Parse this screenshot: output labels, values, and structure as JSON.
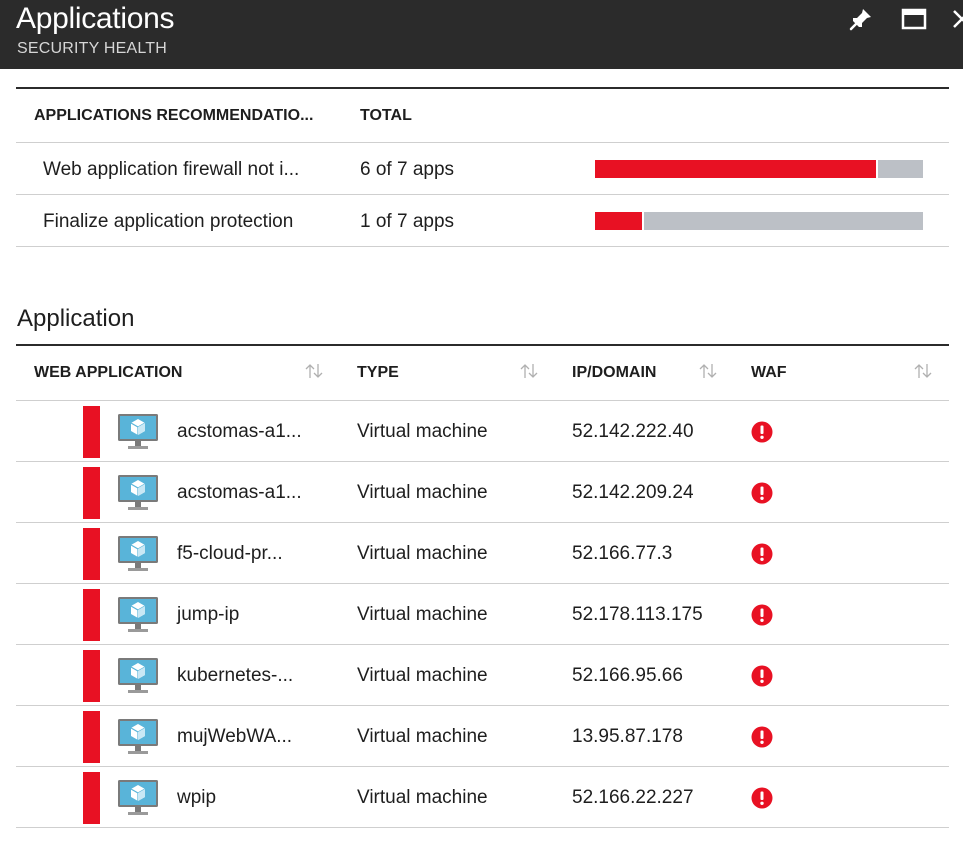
{
  "header": {
    "title": "Applications",
    "subtitle": "SECURITY HEALTH",
    "icons": [
      "pin-icon",
      "maximize-icon",
      "close-icon"
    ]
  },
  "recommendations": {
    "columns": [
      "APPLICATIONS RECOMMENDATIO...",
      "TOTAL"
    ],
    "rows": [
      {
        "name": "Web application firewall not i...",
        "total": "6 of 7 apps",
        "affected": 6,
        "of": 7
      },
      {
        "name": "Finalize application protection",
        "total": "1 of 7 apps",
        "affected": 1,
        "of": 7
      }
    ]
  },
  "applications": {
    "section_title": "Application",
    "columns": [
      "WEB APPLICATION",
      "TYPE",
      "IP/DOMAIN",
      "WAF"
    ],
    "rows": [
      {
        "name": "acstomas-a1...",
        "type": "Virtual machine",
        "ip": "52.142.222.40"
      },
      {
        "name": "acstomas-a1...",
        "type": "Virtual machine",
        "ip": "52.142.209.24"
      },
      {
        "name": "f5-cloud-pr...",
        "type": "Virtual machine",
        "ip": "52.166.77.3"
      },
      {
        "name": "jump-ip",
        "type": "Virtual machine",
        "ip": "52.178.113.175"
      },
      {
        "name": "kubernetes-...",
        "type": "Virtual machine",
        "ip": "52.166.95.66"
      },
      {
        "name": "mujWebWA...",
        "type": "Virtual machine",
        "ip": "13.95.87.178"
      },
      {
        "name": "wpip",
        "type": "Virtual machine",
        "ip": "52.166.22.227"
      }
    ]
  },
  "colors": {
    "header_bg": "#2b2b2b",
    "severity_red": "#e81123",
    "bar_gray": "#bcc0c6",
    "vm_blue": "#59b4d9"
  }
}
